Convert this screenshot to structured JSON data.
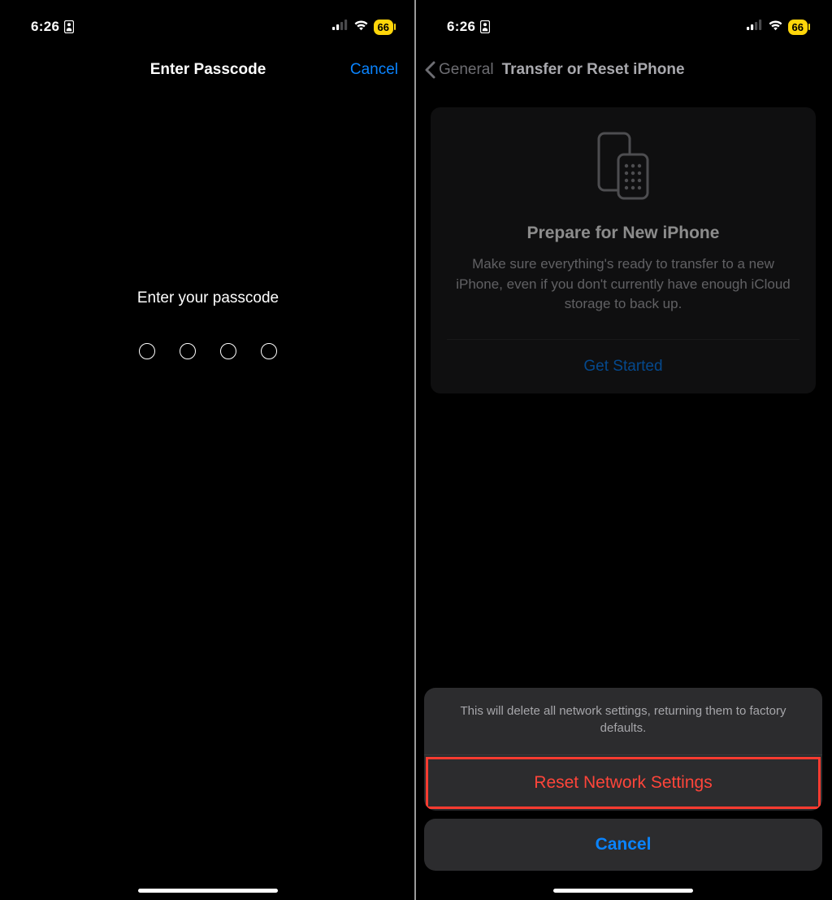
{
  "status": {
    "time": "6:26",
    "battery": "66"
  },
  "left": {
    "title": "Enter Passcode",
    "cancel": "Cancel",
    "prompt": "Enter your passcode"
  },
  "right": {
    "back_label": "General",
    "title": "Transfer or Reset iPhone",
    "card": {
      "title": "Prepare for New iPhone",
      "desc": "Make sure everything's ready to transfer to a new iPhone, even if you don't currently have enough iCloud storage to back up.",
      "action": "Get Started"
    },
    "sheet": {
      "message": "This will delete all network settings, returning them to factory defaults.",
      "reset": "Reset Network Settings",
      "cancel": "Cancel"
    }
  }
}
